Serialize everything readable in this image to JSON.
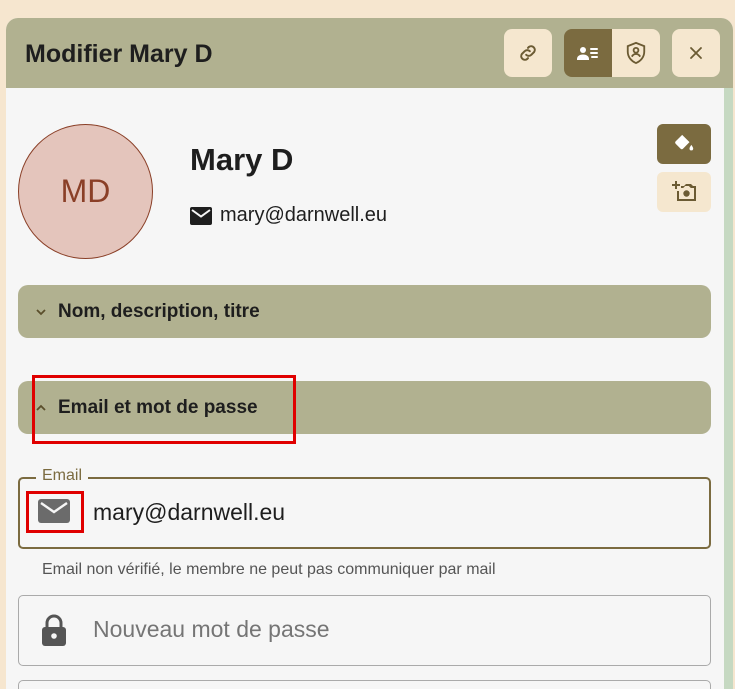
{
  "header": {
    "title": "Modifier Mary D"
  },
  "profile": {
    "initials": "MD",
    "name": "Mary D",
    "email": "mary@darnwell.eu"
  },
  "sections": [
    {
      "label": "Nom, description, titre",
      "expanded": false
    },
    {
      "label": "Email et mot de passe",
      "expanded": true
    }
  ],
  "email_field": {
    "legend": "Email",
    "value": "mary@darnwell.eu",
    "helper": "Email non vérifié, le membre ne peut pas communiquer par mail"
  },
  "password_field": {
    "placeholder": "Nouveau mot de passe"
  },
  "icons": {
    "link": "link-icon",
    "profile": "contact-card-icon",
    "security": "shield-user-icon",
    "close": "close-icon",
    "paint": "paint-bucket-icon",
    "photo": "add-photo-icon",
    "mail": "mail-icon",
    "lock": "lock-icon"
  },
  "colors": {
    "header": "#b1b190",
    "accent": "#7b6b40",
    "light_button": "#f5e7cf",
    "avatar_bg": "#e4c5bc",
    "avatar_text": "#8a3f27",
    "highlight": "#e00000"
  }
}
